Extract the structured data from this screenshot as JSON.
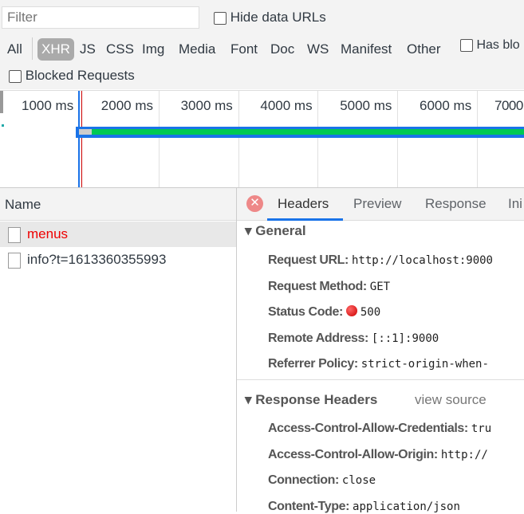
{
  "filter": {
    "placeholder": "Filter",
    "hide_data_urls": "Hide data URLs",
    "has_blocked": "Has blo",
    "blocked_requests": "Blocked Requests"
  },
  "types": [
    "All",
    "XHR",
    "JS",
    "CSS",
    "Img",
    "Media",
    "Font",
    "Doc",
    "WS",
    "Manifest",
    "Other"
  ],
  "selected_type": "XHR",
  "timeline": {
    "ticks": [
      "1000 ms",
      "2000 ms",
      "3000 ms",
      "4000 ms",
      "5000 ms",
      "6000 ms",
      "7000"
    ]
  },
  "list": {
    "header": "Name",
    "rows": [
      {
        "name": "menus",
        "error": true,
        "selected": true
      },
      {
        "name": "info?t=1613360355993",
        "error": false,
        "selected": false
      }
    ]
  },
  "details": {
    "tabs": [
      "Headers",
      "Preview",
      "Response",
      "Ini"
    ],
    "active_tab": "Headers",
    "general": {
      "title": "General",
      "items": [
        {
          "k": "Request URL:",
          "v": "http://localhost:9000"
        },
        {
          "k": "Request Method:",
          "v": "GET"
        },
        {
          "k": "Status Code:",
          "v": "500"
        },
        {
          "k": "Remote Address:",
          "v": "[::1]:9000"
        },
        {
          "k": "Referrer Policy:",
          "v": "strict-origin-when-"
        }
      ]
    },
    "response": {
      "title": "Response Headers",
      "view_source": "view source",
      "items": [
        {
          "k": "Access-Control-Allow-Credentials:",
          "v": "tru"
        },
        {
          "k": "Access-Control-Allow-Origin:",
          "v": "http://"
        },
        {
          "k": "Connection:",
          "v": "close"
        },
        {
          "k": "Content-Type:",
          "v": "application/json"
        }
      ]
    }
  },
  "colors": {
    "error": "#e00",
    "accent": "#1a73e8",
    "waterfall_green": "#00c853"
  }
}
